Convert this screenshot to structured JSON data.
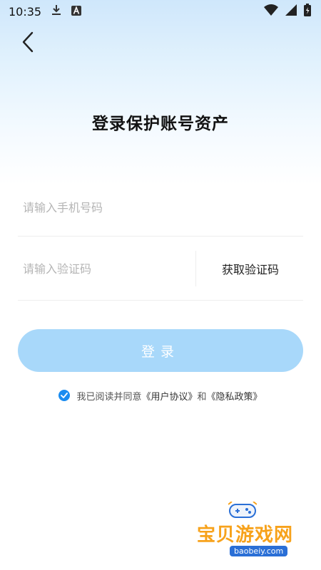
{
  "status_bar": {
    "time": "10:35",
    "icons": [
      "download-icon",
      "a-badge-icon",
      "wifi-icon",
      "signal-icon",
      "battery-icon"
    ]
  },
  "header": {
    "back_icon": "chevron-left-icon",
    "title": "登录保护账号资产"
  },
  "form": {
    "phone_placeholder": "请输入手机号码",
    "phone_value": "",
    "code_placeholder": "请输入验证码",
    "code_value": "",
    "get_code_label": "获取验证码"
  },
  "login_button": {
    "label": "登录"
  },
  "agreement": {
    "checked": true,
    "prefix": "我已阅读并同意",
    "user_agreement": "《用户协议》",
    "conjunction": "和",
    "privacy_policy": "《隐私政策》"
  },
  "watermark": {
    "text": "宝贝游戏网",
    "url": "baobeiy.com"
  },
  "colors": {
    "accent": "#1a8cf0",
    "login_button_bg": "#a8d8fa",
    "gradient_top": "#cfe7fb",
    "watermark": "#f7a21b"
  }
}
